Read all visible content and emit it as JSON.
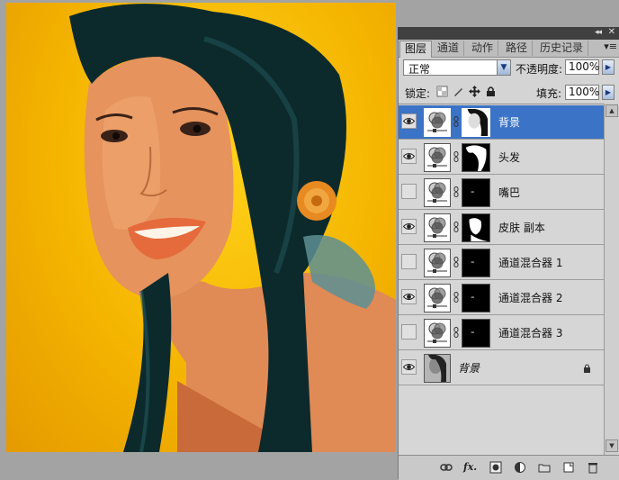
{
  "panel": {
    "tabs": [
      {
        "label": "图层"
      },
      {
        "label": "通道"
      },
      {
        "label": "动作"
      },
      {
        "label": "路径"
      },
      {
        "label": "历史记录"
      }
    ],
    "collapse_glyph": "◂◂",
    "close_glyph": "✕",
    "menu_glyph": "▾≡"
  },
  "controls": {
    "blend_mode": "正常",
    "opacity_label": "不透明度:",
    "opacity_value": "100%",
    "lock_label": "锁定:",
    "fill_label": "填充:",
    "fill_value": "100%"
  },
  "layers": [
    {
      "name": "背景",
      "visible": true,
      "selected": true,
      "type": "adjustment",
      "mask": "portrait"
    },
    {
      "name": "头发",
      "visible": true,
      "selected": false,
      "type": "adjustment",
      "mask": "hair"
    },
    {
      "name": "嘴巴",
      "visible": false,
      "selected": false,
      "type": "adjustment",
      "mask": "dot"
    },
    {
      "name": "皮肤 副本",
      "visible": true,
      "selected": false,
      "type": "adjustment",
      "mask": "skin"
    },
    {
      "name": "通道混合器 1",
      "visible": false,
      "selected": false,
      "type": "adjustment",
      "mask": "dot"
    },
    {
      "name": "通道混合器 2",
      "visible": true,
      "selected": false,
      "type": "adjustment",
      "mask": "dot"
    },
    {
      "name": "通道混合器 3",
      "visible": false,
      "selected": false,
      "type": "adjustment",
      "mask": "dot"
    },
    {
      "name": "背景",
      "visible": true,
      "selected": false,
      "type": "background",
      "mask": "none",
      "locked": true
    }
  ],
  "bottom_bar": {
    "fx_label": "fx."
  },
  "colors": {
    "selection": "#3b73c6",
    "canvas_bg": "#f4b400",
    "panel_bg": "#d4d4d4"
  }
}
